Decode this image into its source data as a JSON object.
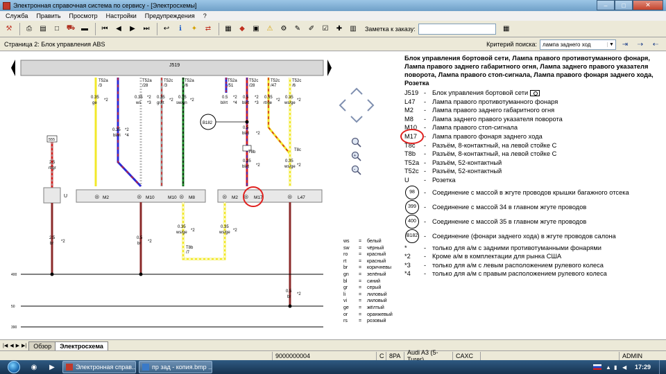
{
  "window": {
    "title": "Электронная справочная система по сервису - [Электросхемы]",
    "controls": {
      "minimize": "–",
      "maximize": "□",
      "close": "✕"
    }
  },
  "menu": [
    "Служба",
    "Править",
    "Просмотр",
    "Настройки",
    "Предупреждения",
    "?"
  ],
  "toolbar": {
    "note_label": "Заметка к заказу:",
    "note_value": ""
  },
  "subbar": {
    "page_title": "Страница 2: Блок управления ABS",
    "search_label": "Критерий поиска:",
    "search_value": "лампа заднего ход"
  },
  "diagram": {
    "unit_label": "J519",
    "connectors": [
      {
        "id": "T52a",
        "pin": "/3",
        "color": "ge",
        "size": "0.35"
      },
      {
        "id": "T52a",
        "pin": "/28",
        "color": "ws",
        "size": "0.35"
      },
      {
        "id": "T52c",
        "pin": "/3",
        "color": "gr/rt",
        "size": "0.35"
      },
      {
        "id": "T52a",
        "pin": "/6",
        "color": "sw/gn",
        "size": "0.35"
      },
      {
        "id": "T52a",
        "pin": "/51",
        "color": "bl/rt",
        "size": "0.5"
      },
      {
        "id": "T52c",
        "pin": "/28",
        "color": "bl/rt",
        "size": "0.5"
      },
      {
        "id": "T52c",
        "pin": "/47",
        "color": "rt/ge",
        "size": "0.35"
      },
      {
        "id": "T52c",
        "pin": "/6",
        "color": "ws/ge",
        "size": "0.35"
      }
    ],
    "labels": {
      "s555": "555",
      "u_size": "2.5",
      "u_color": "rt/gr",
      "u": "U",
      "b182": "B182",
      "t8b": "T8b",
      "t8c": "T8c",
      "t8c_pin": "/7",
      "t8b2": "T8b",
      "t8b2_pin": "/7",
      "bl_vi": "bl/vi",
      "bl_vi_size": "0.35",
      "bl_rt_size": "0.35",
      "bl_rt": "bl/rt",
      "m2": "M2",
      "m10": "M10",
      "m10b": "M10",
      "m8": "M8",
      "m2b": "M2",
      "m17": "M17",
      "l47": "L47",
      "ws_ge_1_size": "0.35",
      "ws_ge_1": "ws/ge",
      "ws_ge_2_size": "0.35",
      "ws_ge_2": "ws/ge",
      "br_a_size": "2.5",
      "br_a": "br",
      "br_b_size": "0.5",
      "br_b": "br",
      "br_c_size": "0.5",
      "br_c": "br",
      "note2": "*2",
      "note3": "*3",
      "note4": "*4",
      "bus_400": "400",
      "bus_50": "50",
      "bus_390": "390"
    }
  },
  "legend": {
    "heading": "Блок управления бортовой сети, Лампа правого противотуманного фонаря, Лампа правого заднего габаритного огня, Лампа заднего правого указателя поворота, Лампа правого стоп-сигнала, Лампа правого фонаря заднего хода, Розетка",
    "items": [
      {
        "code": "J519",
        "desc": "Блок управления бортовой сети"
      },
      {
        "code": "L47",
        "desc": "Лампа правого противотуманного фонаря"
      },
      {
        "code": "M2",
        "desc": "Лампа правого заднего габаритного огня"
      },
      {
        "code": "M8",
        "desc": "Лампа заднего правого указателя поворота"
      },
      {
        "code": "M10",
        "desc": "Лампа правого стоп-сигнала"
      },
      {
        "code": "M17",
        "desc": "Лампа правого фонаря заднего хода"
      },
      {
        "code": "T8c",
        "desc": "Разъём, 8-контактный, на левой стойке С"
      },
      {
        "code": "T8b",
        "desc": "Разъём, 8-контактный, на левой стойке С"
      },
      {
        "code": "T52a",
        "desc": "Разъём, 52-контактный"
      },
      {
        "code": "T52c",
        "desc": "Разъём, 52-контактный"
      },
      {
        "code": "U",
        "desc": "Розетка"
      }
    ],
    "grounds": [
      {
        "code": "98",
        "desc": "Соединение с массой в жгуте проводов крышки багажного отсека"
      },
      {
        "code": "399",
        "desc": "Соединение с массой 34 в главном жгуте проводов"
      },
      {
        "code": "400",
        "desc": "Соединение с массой 35 в главном жгуте проводов"
      },
      {
        "code": "B182",
        "desc": "Соединение (фонари заднего хода) в жгуте проводов салона"
      }
    ],
    "notes": [
      {
        "code": "*",
        "desc": "только для а/м с задними противотуманными фонарями"
      },
      {
        "code": "*2",
        "desc": "Кроме а/м в комплектации для рынка США"
      },
      {
        "code": "*3",
        "desc": "только для а/м с левым расположением рулевого колеса"
      },
      {
        "code": "*4",
        "desc": "только для а/м с правым расположением рулевого колеса"
      }
    ],
    "dash": "-"
  },
  "color_codes": [
    {
      "k": "ws",
      "v": "белый"
    },
    {
      "k": "sw",
      "v": "чёрный"
    },
    {
      "k": "ro",
      "v": "красный"
    },
    {
      "k": "rt",
      "v": "красный"
    },
    {
      "k": "br",
      "v": "коричневы"
    },
    {
      "k": "gn",
      "v": "зелёный"
    },
    {
      "k": "bl",
      "v": "синий"
    },
    {
      "k": "gr",
      "v": "серый"
    },
    {
      "k": "li",
      "v": "лиловый"
    },
    {
      "k": "vi",
      "v": "лиловый"
    },
    {
      "k": "ge",
      "v": "жёлтый"
    },
    {
      "k": "or",
      "v": "оранжевый"
    },
    {
      "k": "rs",
      "v": "розовый"
    }
  ],
  "color_eq": "=",
  "tabs": [
    {
      "label": "Обзор",
      "active": false
    },
    {
      "label": "Электросхема",
      "active": true
    }
  ],
  "status": {
    "doc_no": "9000000004",
    "c": "C",
    "code": "8PA",
    "model": "Audi A3 (5-Turer)",
    "engine": "CAXC",
    "user": "ADMIN"
  },
  "taskbar": {
    "items": [
      {
        "label": "Электронная справ..."
      },
      {
        "label": "пр зад - копия.bmp ..."
      }
    ],
    "clock": "17:29"
  },
  "accent_colors": {
    "highlight_circle": "#e0201e",
    "wire_blue": "#2a2ad8",
    "wire_red": "#d42020",
    "wire_yellow": "#f2e82a",
    "wire_brown": "#8b2a2a",
    "wire_green": "#1f8f2a"
  }
}
